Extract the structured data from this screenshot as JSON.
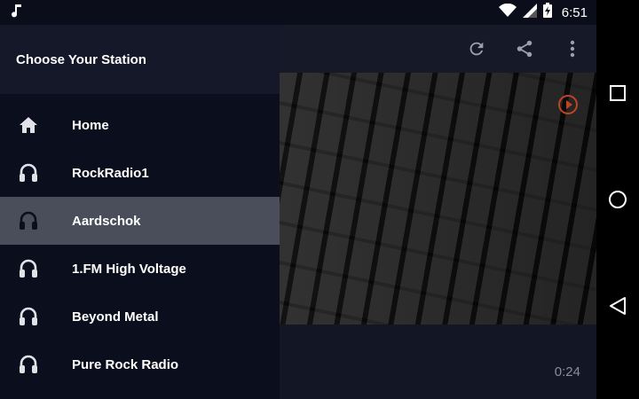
{
  "status_bar": {
    "time": "6:51",
    "left_icon": "music-note-icon",
    "right_icons": [
      "wifi-icon",
      "cell-signal-icon",
      "battery-charging-icon"
    ]
  },
  "app_bar": {
    "actions": [
      "refresh-icon",
      "share-icon",
      "more-vert-icon"
    ]
  },
  "drawer": {
    "title": "Choose Your Station",
    "items": [
      {
        "label": "Home",
        "icon": "home-icon",
        "active": false
      },
      {
        "label": "RockRadio1",
        "icon": "headphones-icon",
        "active": false
      },
      {
        "label": "Aardschok",
        "icon": "headphones-icon",
        "active": true
      },
      {
        "label": "1.FM High Voltage",
        "icon": "headphones-icon",
        "active": false
      },
      {
        "label": "Beyond Metal",
        "icon": "headphones-icon",
        "active": false
      },
      {
        "label": "Pure Rock Radio",
        "icon": "headphones-icon",
        "active": false
      }
    ]
  },
  "player": {
    "elapsed": "0:24"
  },
  "nav_bar": [
    "recents-icon",
    "home-circle-icon",
    "back-icon"
  ],
  "colors": {
    "drawer_bg": "#0b0f1d",
    "drawer_header_bg": "#141828",
    "active_item_bg": "#4a4d5a",
    "accent_play": "#c0441f"
  }
}
